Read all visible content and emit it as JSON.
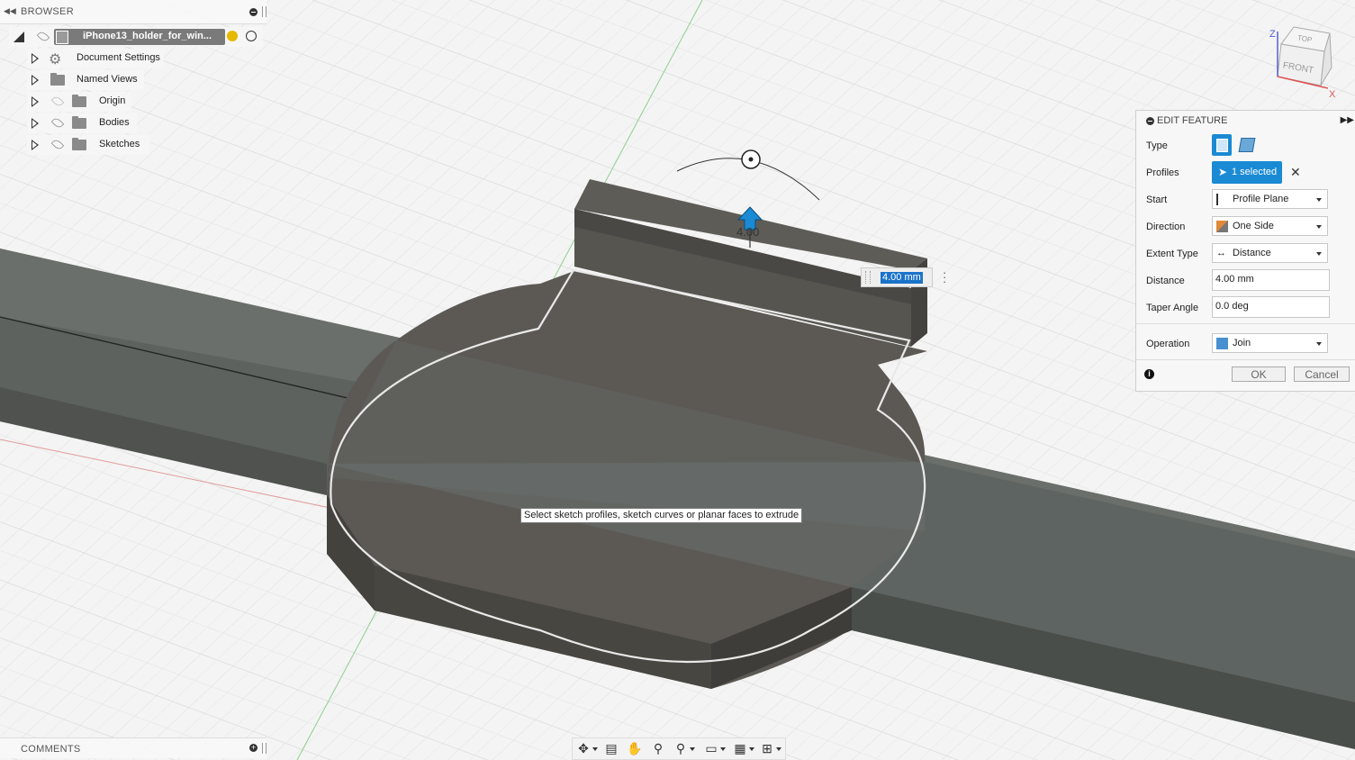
{
  "browser": {
    "title": "BROWSER",
    "document_name": "iPhone13_holder_for_win...",
    "items": [
      {
        "label": "Document Settings",
        "icon": "gear-icon"
      },
      {
        "label": "Named Views",
        "icon": "folder-icon"
      },
      {
        "label": "Origin",
        "icon": "folder-icon"
      },
      {
        "label": "Bodies",
        "icon": "folder-icon"
      },
      {
        "label": "Sketches",
        "icon": "folder-icon"
      }
    ]
  },
  "comments": {
    "title": "COMMENTS"
  },
  "edit_feature": {
    "title": "EDIT FEATURE",
    "type_label": "Type",
    "profiles_label": "Profiles",
    "profiles_value": "1 selected",
    "start_label": "Start",
    "start_value": "Profile Plane",
    "direction_label": "Direction",
    "direction_value": "One Side",
    "extent_label": "Extent Type",
    "extent_value": "Distance",
    "distance_label": "Distance",
    "distance_value": "4.00 mm",
    "taper_label": "Taper Angle",
    "taper_value": "0.0 deg",
    "operation_label": "Operation",
    "operation_value": "Join",
    "ok_label": "OK",
    "cancel_label": "Cancel"
  },
  "viewport": {
    "tooltip": "Select sketch profiles, sketch curves or planar faces to extrude",
    "distance_input": "4.00 mm",
    "dimension_label": "4.00"
  },
  "viewcube": {
    "top": "TOP",
    "front": "FRONT",
    "axis_z": "Z",
    "axis_x": "X"
  },
  "colors": {
    "accent": "#1a8ad4",
    "model": "#5a5853",
    "background": "#f2f2f2"
  }
}
